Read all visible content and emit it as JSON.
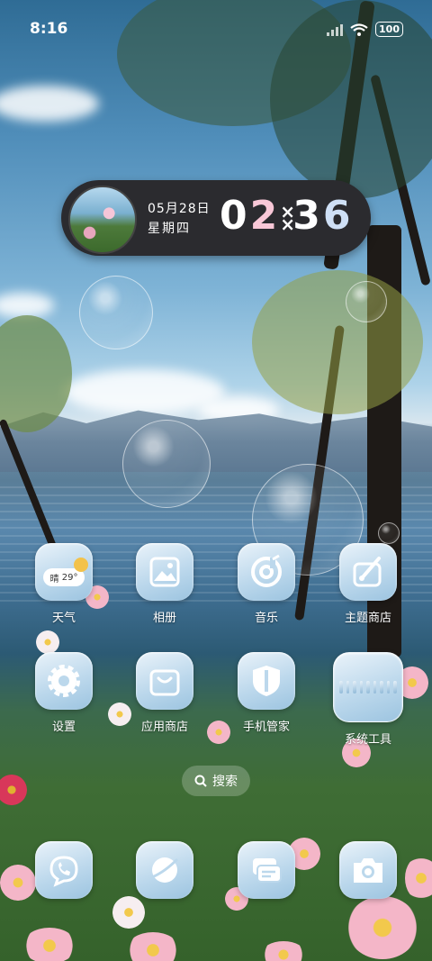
{
  "status_bar": {
    "time": "8:16",
    "battery": "100"
  },
  "widget": {
    "date": "05月28日",
    "weekday": "星期四",
    "hour_1": "0",
    "hour_2": "2",
    "separator": "×\n×",
    "minute_1": "3",
    "minute_2": "6"
  },
  "apps": [
    {
      "label": "天气",
      "icon": "weather-icon",
      "temp": "29°",
      "weather_text": "晴"
    },
    {
      "label": "相册",
      "icon": "gallery-icon"
    },
    {
      "label": "音乐",
      "icon": "music-icon"
    },
    {
      "label": "主题商店",
      "icon": "theme-store-icon"
    },
    {
      "label": "设置",
      "icon": "settings-icon"
    },
    {
      "label": "应用商店",
      "icon": "app-store-icon"
    },
    {
      "label": "手机管家",
      "icon": "security-icon"
    },
    {
      "label": "系统工具",
      "icon": "folder-icon"
    }
  ],
  "search": {
    "label": "搜索"
  },
  "dock": [
    {
      "icon": "phone-icon"
    },
    {
      "icon": "browser-icon"
    },
    {
      "icon": "messages-icon"
    },
    {
      "icon": "camera-icon"
    }
  ],
  "colors": {
    "icon_bg": "#bcd8ec",
    "icon_glyph": "#ffffff",
    "widget_bg": "#2b2b2f",
    "accent_pink": "#f8c7d7",
    "accent_blue": "#cfe0f6"
  }
}
